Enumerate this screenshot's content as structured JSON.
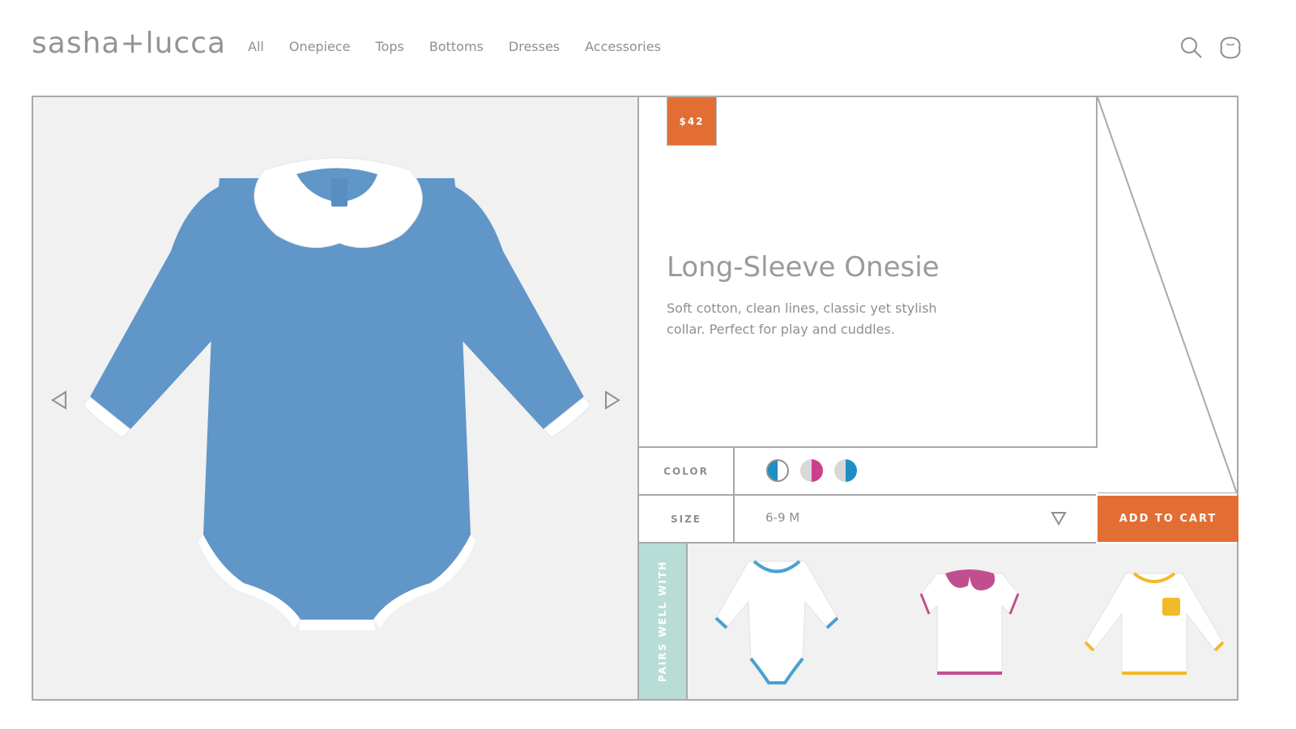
{
  "header": {
    "logo": "sasha+lucca",
    "nav": [
      "All",
      "Onepiece",
      "Tops",
      "Bottoms",
      "Dresses",
      "Accessories"
    ]
  },
  "product": {
    "price": "$42",
    "title": "Long-Sleeve Onesie",
    "description": "Soft cotton, clean lines, classic yet stylish collar. Perfect for play and cuddles.",
    "color_label": "COLOR",
    "size_label": "SIZE",
    "size_value": "6-9 M",
    "add_to_cart": "ADD TO CART",
    "swatches": [
      {
        "name": "blue-white",
        "color": "#1e8fc2"
      },
      {
        "name": "pink-grey",
        "color": "#cc3f8e"
      },
      {
        "name": "blue-grey",
        "color": "#1e8fc2"
      }
    ]
  },
  "pairs": {
    "label": "PAIRS WELL WITH",
    "items": [
      "blue-trim-onesie",
      "pink-collar-tee",
      "yellow-pocket-tee"
    ]
  },
  "colors": {
    "accent": "#e26e34",
    "mint": "#b8ddd6",
    "border": "#a9a9a9",
    "product_blue": "#6196c8"
  }
}
